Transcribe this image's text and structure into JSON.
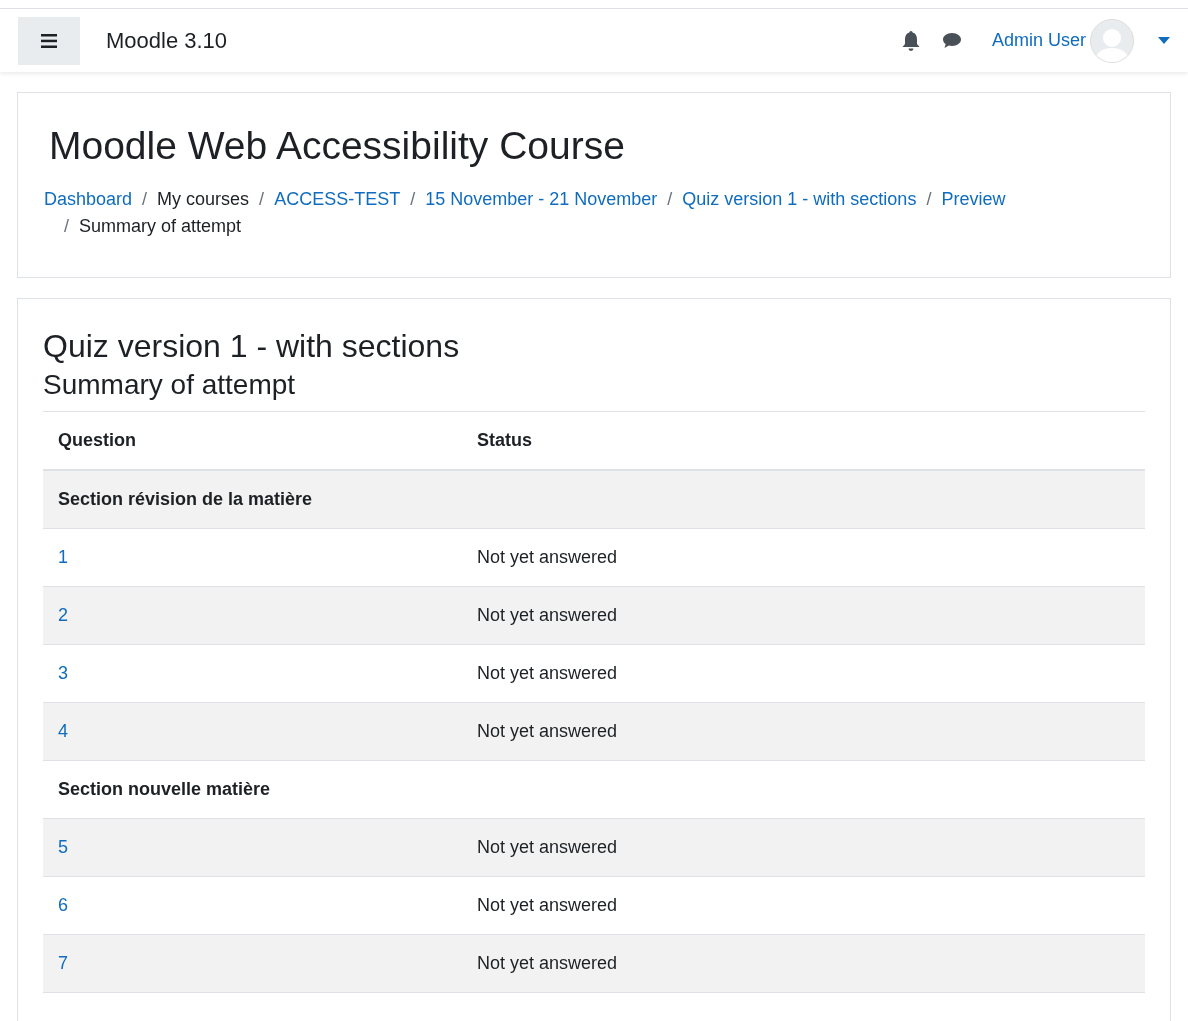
{
  "navbar": {
    "site_name": "Moodle 3.10",
    "user_name": "Admin User"
  },
  "course": {
    "title": "Moodle Web Accessibility Course",
    "breadcrumb": [
      {
        "label": "Dashboard",
        "link": true
      },
      {
        "separator": "/",
        "label": "My courses",
        "link": false
      },
      {
        "separator": "/",
        "label": "ACCESS-TEST",
        "link": true
      },
      {
        "separator": "/",
        "label": "15 November - 21 November",
        "link": true
      },
      {
        "separator": "/",
        "label": "Quiz version 1 - with sections",
        "link": true
      },
      {
        "separator": "/",
        "label": "Preview",
        "link": true
      },
      {
        "separator": "/",
        "label": "Summary of attempt",
        "link": false
      }
    ]
  },
  "quiz": {
    "title": "Quiz version 1 - with sections",
    "subtitle": "Summary of attempt",
    "table": {
      "columns": [
        "Question",
        "Status"
      ],
      "rows": [
        {
          "kind": "section",
          "label": "Section révision de la matière"
        },
        {
          "kind": "question",
          "number": "1",
          "status": "Not yet answered"
        },
        {
          "kind": "question",
          "number": "2",
          "status": "Not yet answered"
        },
        {
          "kind": "question",
          "number": "3",
          "status": "Not yet answered"
        },
        {
          "kind": "question",
          "number": "4",
          "status": "Not yet answered"
        },
        {
          "kind": "section",
          "label": "Section nouvelle matière"
        },
        {
          "kind": "question",
          "number": "5",
          "status": "Not yet answered"
        },
        {
          "kind": "question",
          "number": "6",
          "status": "Not yet answered"
        },
        {
          "kind": "question",
          "number": "7",
          "status": "Not yet answered"
        }
      ]
    }
  }
}
